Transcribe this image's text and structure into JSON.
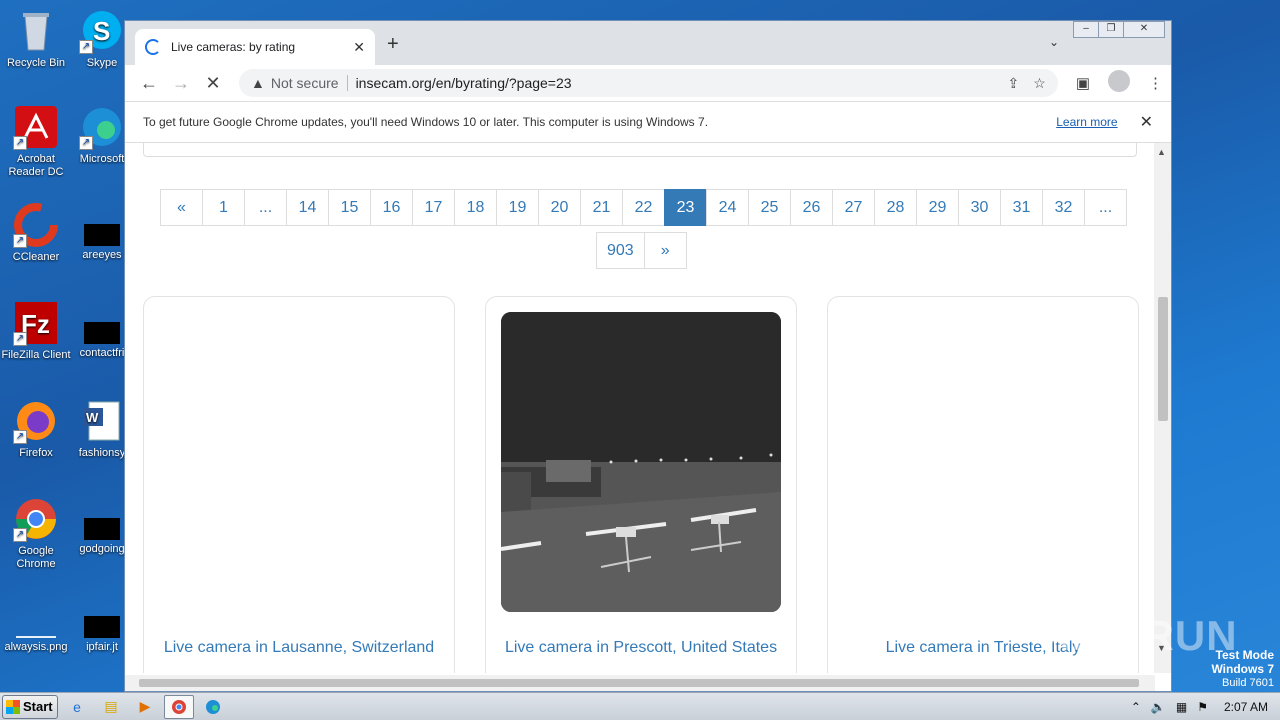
{
  "desktop": {
    "icons_left": [
      {
        "label": "Recycle Bin",
        "icon": "recycle-bin-icon"
      },
      {
        "label": "Acrobat Reader DC",
        "icon": "acrobat-icon"
      },
      {
        "label": "CCleaner",
        "icon": "ccleaner-icon"
      },
      {
        "label": "FileZilla Client",
        "icon": "filezilla-icon"
      },
      {
        "label": "Firefox",
        "icon": "firefox-icon"
      },
      {
        "label": "Google Chrome",
        "icon": "chrome-icon"
      },
      {
        "label": "alwaysis.png",
        "icon": "image-file-icon"
      }
    ],
    "icons_right": [
      {
        "label": "Skype",
        "icon": "skype-icon"
      },
      {
        "label": "Microsoft",
        "icon": "edge-icon"
      },
      {
        "label": "areeyes",
        "icon": "file-icon"
      },
      {
        "label": "contactfri",
        "icon": "file-icon"
      },
      {
        "label": "fashionsy",
        "icon": "word-icon"
      },
      {
        "label": "godgoing",
        "icon": "file-icon"
      },
      {
        "label": "ipfair.jt",
        "icon": "file-icon"
      }
    ]
  },
  "browser": {
    "tab_title": "Live cameras: by rating",
    "new_tab_symbol": "+",
    "address": {
      "security_label": "Not secure",
      "url": "insecam.org/en/byrating/?page=23"
    },
    "infobar": {
      "message": "To get future Google Chrome updates, you'll need Windows 10 or later. This computer is using Windows 7.",
      "link": "Learn more"
    }
  },
  "page": {
    "pagination_row1": [
      "«",
      "1",
      "...",
      "14",
      "15",
      "16",
      "17",
      "18",
      "19",
      "20",
      "21",
      "22",
      "23",
      "24",
      "25",
      "26",
      "27",
      "28",
      "29",
      "30",
      "31",
      "32",
      "..."
    ],
    "pagination_row2": [
      "903",
      "»"
    ],
    "current_page": "23",
    "cameras": [
      {
        "caption": "Live camera in Lausanne, Switzerland"
      },
      {
        "caption": "Live camera in Prescott, United States"
      },
      {
        "caption": "Live camera in Trieste, Italy"
      }
    ]
  },
  "overlay": {
    "watermark": "ANY RUN",
    "test_mode": "Test Mode",
    "os": "Windows 7",
    "build": "Build 7601"
  },
  "taskbar": {
    "start_label": "Start",
    "clock": "2:07 AM"
  }
}
